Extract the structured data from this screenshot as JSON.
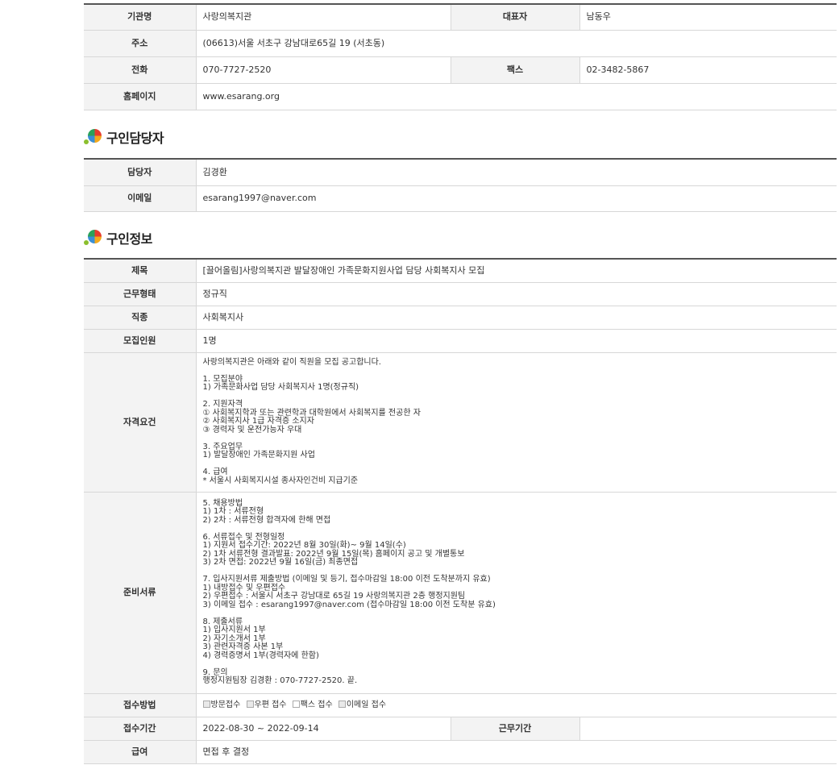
{
  "org": {
    "name_label": "기관명",
    "name": "사랑의복지관",
    "rep_label": "대표자",
    "rep": "남동우",
    "addr_label": "주소",
    "addr": "(06613)서울 서초구 강남대로65길 19 (서초동)",
    "tel_label": "전화",
    "tel": "070-7727-2520",
    "fax_label": "팩스",
    "fax": "02-3482-5867",
    "web_label": "홈페이지",
    "web": "www.esarang.org"
  },
  "contact": {
    "title": "구인담당자",
    "person_label": "담당자",
    "person": "김경환",
    "email_label": "이메일",
    "email": "esarang1997@naver.com"
  },
  "job": {
    "title": "구인정보",
    "subject_label": "제목",
    "subject": "[끌어올림]사랑의복지관 발달장애인 가족문화지원사업 담당 사회복지사 모집",
    "type_label": "근무형태",
    "type": "정규직",
    "occupation_label": "직종",
    "occupation": "사회복지사",
    "headcount_label": "모집인원",
    "headcount": "1명",
    "qual_label": "자격요건",
    "qual": "사랑의복지관은 아래와 같이 직원을 모집 공고합니다.\n\n1. 모집분야\n1) 가족문화사업 담당 사회복지사 1명(정규직)\n\n2. 지원자격\n① 사회복지학과 또는 관련학과 대학원에서 사회복지를 전공한 자\n② 사회복지사 1급 자격증 소지자\n③ 경력자 및 운전가능자 우대\n\n3. 주요업무\n1) 발달장애인 가족문화지원 사업\n\n4. 급여\n* 서울시 사회복지시설 종사자인건비 지급기준",
    "docs_label": "준비서류",
    "docs": "5. 채용방법\n1) 1차 : 서류전형\n2) 2차 : 서류전형 합격자에 한해 면접\n\n6. 서류접수 및 전형일정\n1) 지원서 접수기간: 2022년 8월 30일(화)~ 9월 14일(수)\n2) 1차 서류전형 결과발표: 2022년 9월 15일(목) 홈페이지 공고 및 개별통보\n3) 2차 면접: 2022년 9월 16일(금) 최종면접\n\n7. 입사지원서류 제출방법 (이메일 및 등기, 접수마감일 18:00 이전 도착분까지 유효)\n1) 내방접수 및 우편접수\n2) 우편접수 : 서울시 서초구 강남대로 65길 19 사랑의복지관 2층 행정지원팀\n3) 이메일 접수 : esarang1997@naver.com (접수마감일 18:00 이전 도착분 유효)\n\n8. 제출서류\n1) 입사지원서 1부\n2) 자기소개서 1부\n3) 관련자격증 사본 1부\n4) 경력증명서 1부(경력자에 한함)\n\n9. 문의\n행정지원팀장 김경환 : 070-7727-2520. 끝.",
    "method_label": "접수방법",
    "methods": [
      "방문접수",
      "우편 접수",
      "팩스 접수",
      "이메일 접수"
    ],
    "period_label": "접수기간",
    "period": "2022-08-30 ~ 2022-09-14",
    "work_period_label": "근무기간",
    "work_period": "",
    "salary_label": "급여",
    "salary": "면접 후 결정"
  }
}
